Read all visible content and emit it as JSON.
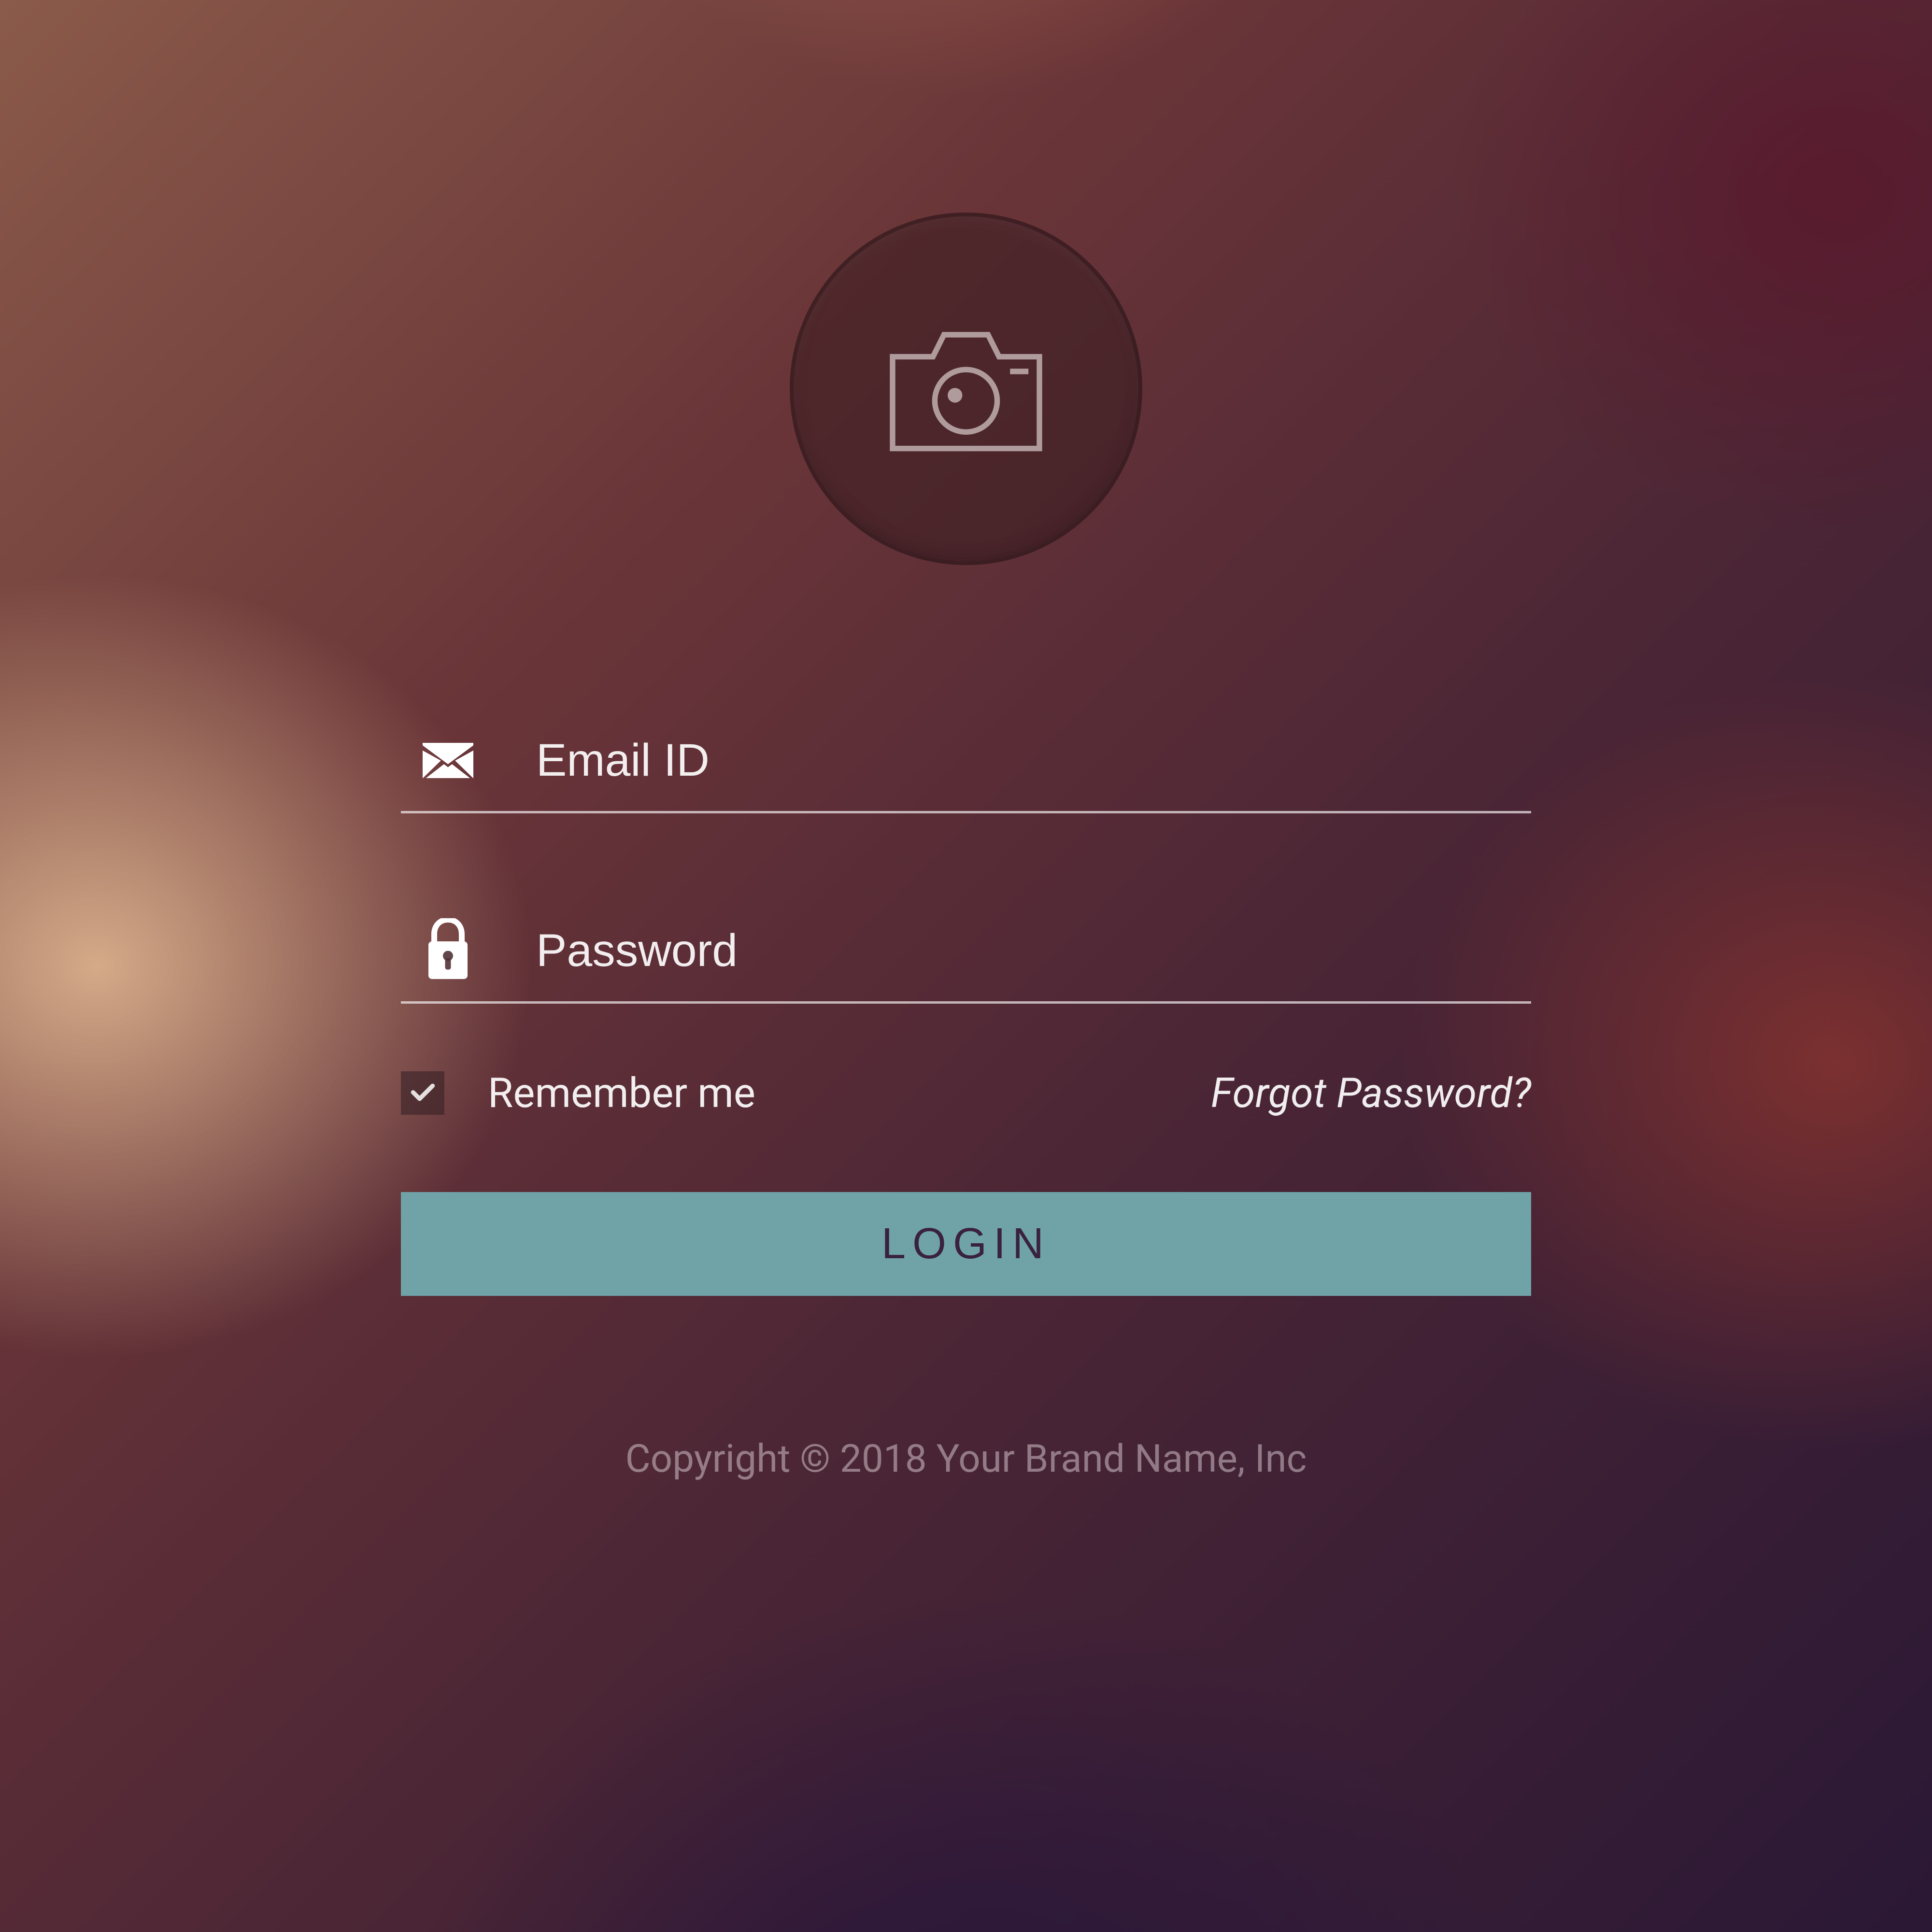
{
  "avatar": {
    "icon": "camera-icon"
  },
  "fields": {
    "email": {
      "placeholder": "Email ID",
      "icon": "mail-icon"
    },
    "password": {
      "placeholder": "Password",
      "icon": "lock-icon"
    }
  },
  "options": {
    "remember_label": "Remember me",
    "remember_checked": true,
    "forgot_label": "Forgot Password?"
  },
  "actions": {
    "login_label": "LOGIN"
  },
  "footer": {
    "copyright": "Copyright © 2018 Your Brand Name, Inc"
  },
  "colors": {
    "button_bg": "#6fa3a8",
    "button_text": "#3a2140",
    "field_text": "#ffffff"
  }
}
